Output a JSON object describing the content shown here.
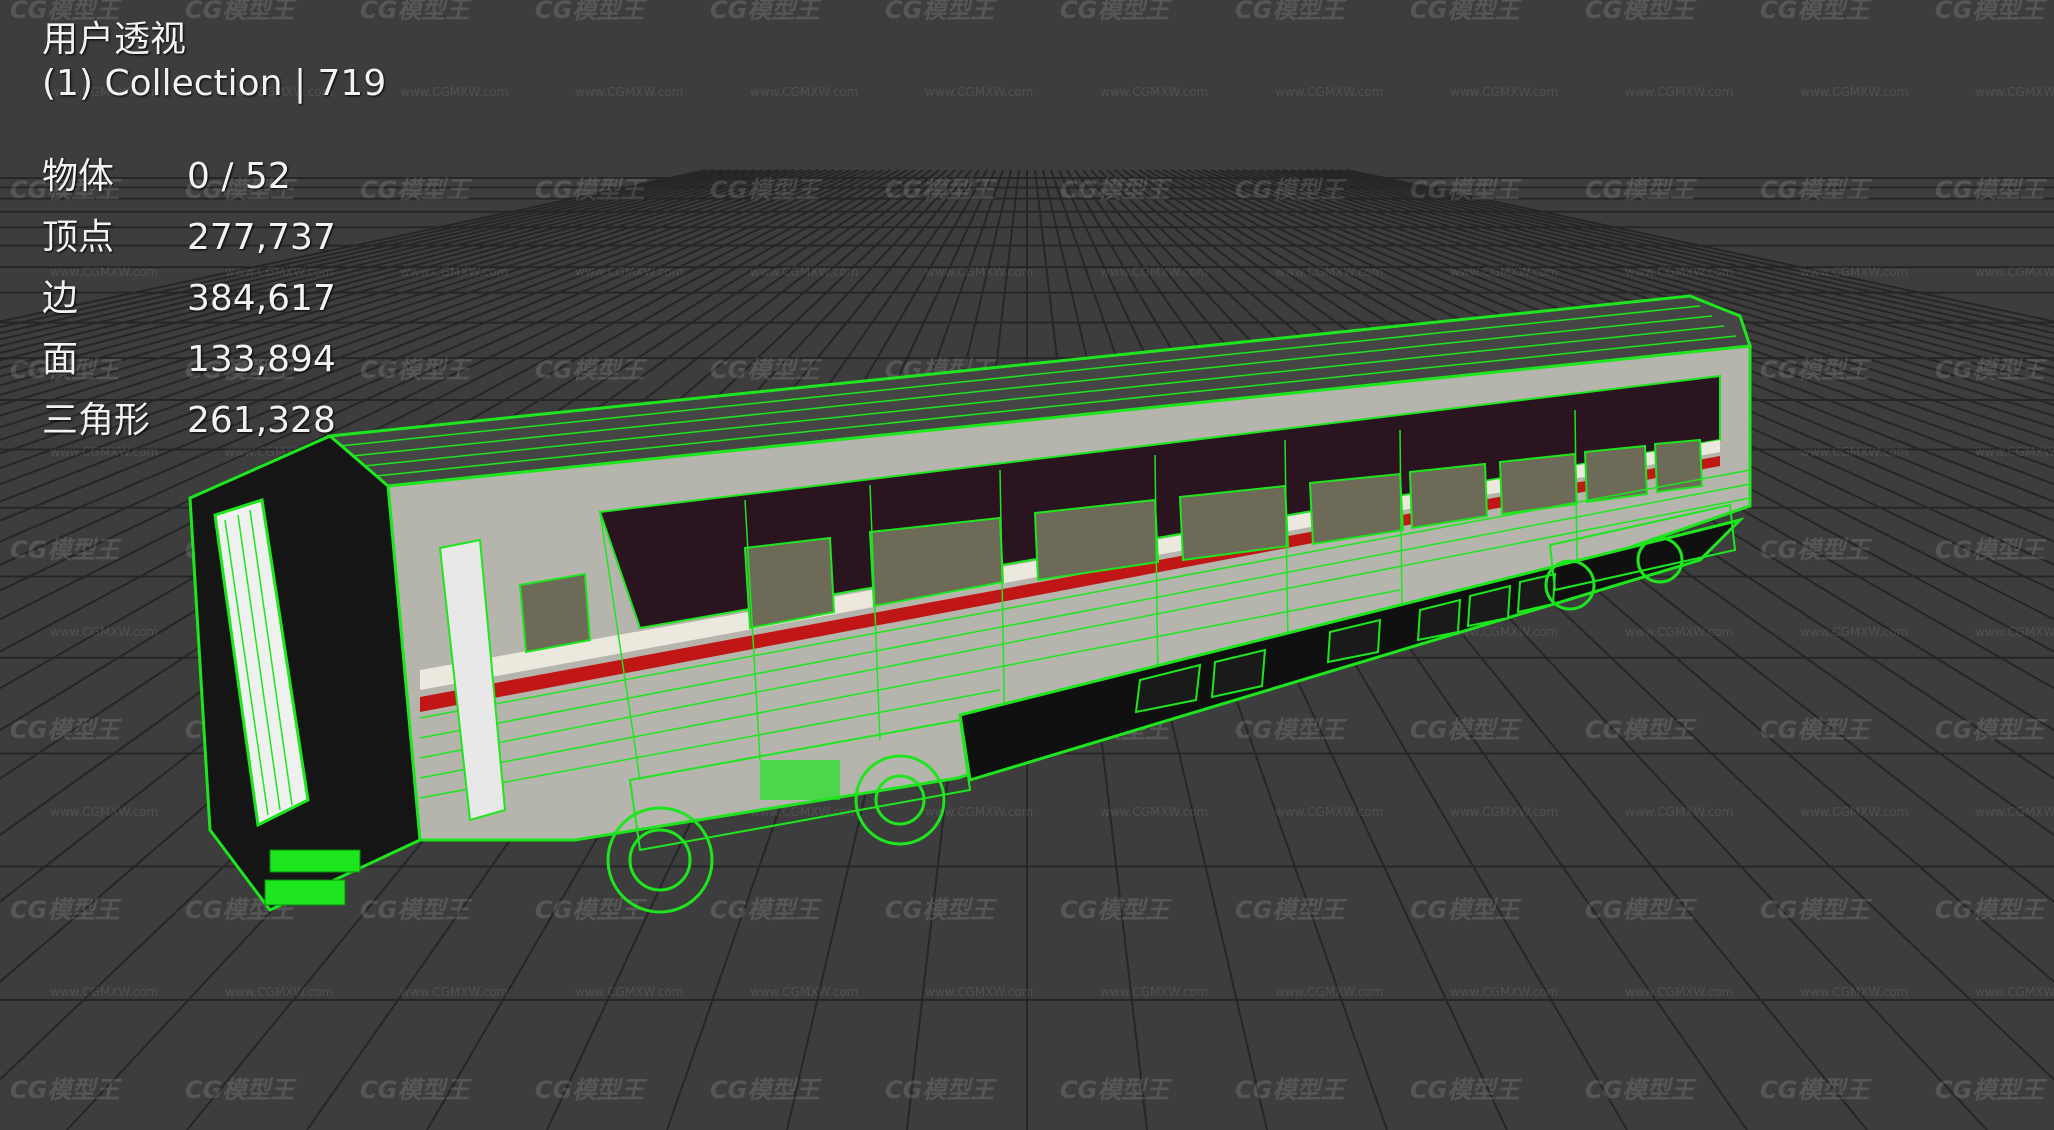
{
  "viewport": {
    "view_name": "用户透视",
    "collection_label": "(1) Collection | 719"
  },
  "statistics": [
    {
      "label": "物体",
      "value": "0 / 52"
    },
    {
      "label": "顶点",
      "value": "277,737"
    },
    {
      "label": "边",
      "value": "384,617"
    },
    {
      "label": "面",
      "value": "133,894"
    },
    {
      "label": "三角形",
      "value": "261,328"
    }
  ],
  "watermark": {
    "logo_text": "CG模型王",
    "url_text": "www.CGMXW.com"
  },
  "colors": {
    "background": "#3d3d3d",
    "grid": "#262626",
    "wireframe": "#1ee61e",
    "model_body": "#b5b5ad",
    "window": "#2a141f",
    "stripe_red": "#c01616"
  }
}
